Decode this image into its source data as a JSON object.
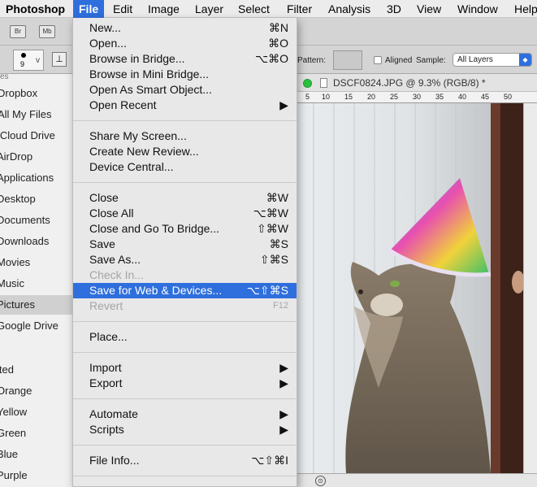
{
  "menubar": {
    "app": "Photoshop",
    "items": [
      "File",
      "Edit",
      "Image",
      "Layer",
      "Select",
      "Filter",
      "Analysis",
      "3D",
      "View",
      "Window",
      "Help"
    ]
  },
  "toolbar": {
    "bridge_btn": "Br",
    "minibridge_btn": "Mb",
    "brush_size": "9",
    "brush_arrow": "v",
    "pattern_label": "Pattern:",
    "aligned_label": "Aligned",
    "sample_label": "Sample:",
    "sample_value": "All Layers"
  },
  "sidebar": {
    "header_fragment": "es",
    "items": [
      "Dropbox",
      "All My Files",
      "iCloud Drive",
      "AirDrop",
      "Applications",
      "Desktop",
      "Documents",
      "Downloads",
      "Movies",
      "Music",
      "Pictures",
      "Google Drive"
    ],
    "tags": [
      "ited",
      "Orange",
      "Yellow",
      "Green",
      "Blue",
      "Purple"
    ],
    "selected": "Pictures"
  },
  "document": {
    "title": "DSCF0824.JPG @ 9.3% (RGB/8) *",
    "ruler_labels": [
      "5",
      "10",
      "15",
      "20",
      "25",
      "30",
      "35",
      "40",
      "45",
      "50"
    ]
  },
  "file_menu": {
    "groups": [
      [
        {
          "label": "New...",
          "shortcut": "⌘N"
        },
        {
          "label": "Open...",
          "shortcut": "⌘O"
        },
        {
          "label": "Browse in Bridge...",
          "shortcut": "⌥⌘O"
        },
        {
          "label": "Browse in Mini Bridge...",
          "shortcut": ""
        },
        {
          "label": "Open As Smart Object...",
          "shortcut": ""
        },
        {
          "label": "Open Recent",
          "shortcut": "▶"
        }
      ],
      [
        {
          "label": "Share My Screen...",
          "shortcut": ""
        },
        {
          "label": "Create New Review...",
          "shortcut": ""
        },
        {
          "label": "Device Central...",
          "shortcut": ""
        }
      ],
      [
        {
          "label": "Close",
          "shortcut": "⌘W"
        },
        {
          "label": "Close All",
          "shortcut": "⌥⌘W"
        },
        {
          "label": "Close and Go To Bridge...",
          "shortcut": "⇧⌘W"
        },
        {
          "label": "Save",
          "shortcut": "⌘S"
        },
        {
          "label": "Save As...",
          "shortcut": "⇧⌘S"
        },
        {
          "label": "Check In...",
          "shortcut": ""
        },
        {
          "label": "Save for Web & Devices...",
          "shortcut": "⌥⇧⌘S"
        },
        {
          "label": "Revert",
          "shortcut": "F12"
        }
      ],
      [
        {
          "label": "Place...",
          "shortcut": ""
        }
      ],
      [
        {
          "label": "Import",
          "shortcut": "▶"
        },
        {
          "label": "Export",
          "shortcut": "▶"
        }
      ],
      [
        {
          "label": "Automate",
          "shortcut": "▶"
        },
        {
          "label": "Scripts",
          "shortcut": "▶"
        }
      ],
      [
        {
          "label": "File Info...",
          "shortcut": "⌥⇧⌘I"
        }
      ]
    ],
    "highlighted": "Save for Web & Devices...",
    "disabled": [
      "Check In...",
      "Revert"
    ]
  },
  "colors": {
    "accent": "#2f6fdd",
    "menu_bg": "#e8e8e8",
    "disabled_text": "#a5a5a5"
  }
}
